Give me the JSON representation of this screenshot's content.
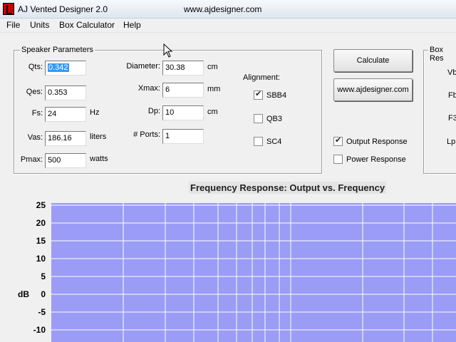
{
  "window": {
    "title": "AJ Vented Designer 2.0",
    "url": "www.ajdesigner.com"
  },
  "menu": [
    {
      "label": "File"
    },
    {
      "label": "Units"
    },
    {
      "label": "Box Calculator"
    },
    {
      "label": "Help"
    }
  ],
  "speaker": {
    "group_title": "Speaker Parameters",
    "qts": {
      "label": "Qts:",
      "value": "0.342",
      "unit": ""
    },
    "qes": {
      "label": "Qes:",
      "value": "0.353",
      "unit": ""
    },
    "fs": {
      "label": "Fs:",
      "value": "24",
      "unit": "Hz"
    },
    "vas": {
      "label": "Vas:",
      "value": "186.16",
      "unit": "liters"
    },
    "pmax": {
      "label": "Pmax:",
      "value": "500",
      "unit": "watts"
    },
    "diameter": {
      "label": "Diameter:",
      "value": "30.38",
      "unit": "cm"
    },
    "xmax": {
      "label": "Xmax:",
      "value": "6",
      "unit": "mm"
    },
    "dp": {
      "label": "Dp:",
      "value": "10",
      "unit": "cm"
    },
    "ports": {
      "label": "# Ports:",
      "value": "1",
      "unit": ""
    }
  },
  "alignment": {
    "label": "Alignment:",
    "options": [
      {
        "label": "SBB4",
        "checked": true
      },
      {
        "label": "QB3",
        "checked": false
      },
      {
        "label": "SC4",
        "checked": false
      }
    ]
  },
  "buttons": {
    "calculate": "Calculate",
    "website": "www.ajdesigner.com"
  },
  "response": {
    "output": {
      "label": "Output Response",
      "checked": true
    },
    "power": {
      "label": "Power Response",
      "checked": false
    }
  },
  "box_results": {
    "group_title": "Box Res",
    "labels": [
      "Vb",
      "Fb",
      "F3",
      "Lp"
    ]
  },
  "chart": {
    "title": "Frequency Response: Output vs. Frequency",
    "ylabel": "dB",
    "yticks": [
      "25",
      "20",
      "15",
      "10",
      "5",
      "0",
      "-5",
      "-10"
    ],
    "plot_color": "#9a9cf6",
    "grid_color": "#ffffff"
  },
  "chart_data": {
    "type": "line",
    "title": "Frequency Response: Output vs. Frequency",
    "xlabel": "",
    "ylabel": "dB",
    "ylim": [
      -10,
      25
    ],
    "yticks": [
      25,
      20,
      15,
      10,
      5,
      0,
      -5,
      -10
    ],
    "x_scale": "log",
    "grid": true,
    "series": []
  }
}
